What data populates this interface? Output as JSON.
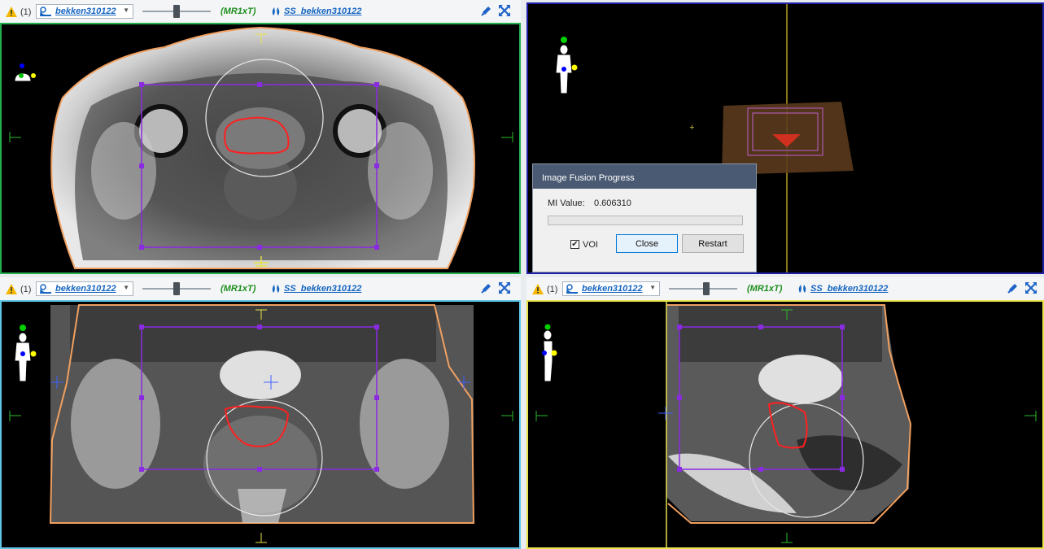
{
  "viewports": [
    {
      "id": "axial",
      "warning_count": "(1)",
      "series": "bekken310122",
      "modality": "(MR1xT)",
      "structure_set": "SS_bekken310122",
      "slider_value": 0.5,
      "border_color": "#22b14c"
    },
    {
      "id": "render3d",
      "border_color": "#1f1fa8"
    },
    {
      "id": "coronal",
      "warning_count": "(1)",
      "series": "bekken310122",
      "modality": "(MR1xT)",
      "structure_set": "SS_bekken310122",
      "slider_value": 0.5,
      "border_color": "#5fc6e6"
    },
    {
      "id": "sagittal",
      "warning_count": "(1)",
      "series": "bekken310122",
      "modality": "(MR1xT)",
      "structure_set": "SS_bekken310122",
      "slider_value": 0.55,
      "border_color": "#e8e34a"
    }
  ],
  "dialog": {
    "title": "Image Fusion Progress",
    "mi_label": "MI Value:",
    "mi_value": "0.606310",
    "progress": 0,
    "voi_label": "VOI",
    "voi_checked": true,
    "close_label": "Close",
    "restart_label": "Restart"
  },
  "colors": {
    "voi_box": "#8a2be2",
    "contour": "#ff2020",
    "body_outline": "#f0a060",
    "crosshair": "#2cbd2c",
    "link": "#1565c0",
    "modality": "#1e8f1e"
  },
  "icons": [
    "warning-icon",
    "series-icon",
    "chevron-down-icon",
    "structure-set-icon",
    "pin-icon",
    "expand-icon",
    "orientation-figure-icon"
  ]
}
